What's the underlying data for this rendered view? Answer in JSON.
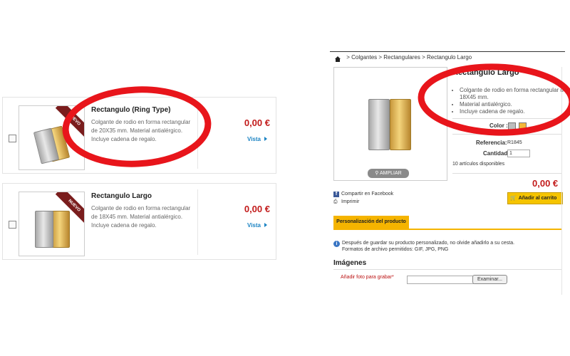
{
  "products": [
    {
      "title": "Rectangulo (Ring Type)",
      "description": "Colgante de rodio en forma rectangular de 20X35 mm. Material antialérgico. Incluye cadena de regalo.",
      "price": "0,00 €",
      "ribbon": "NUEVO",
      "link": "Vista"
    },
    {
      "title": "Rectangulo Largo",
      "description": "Colgante de rodio en forma rectangular de 18X45 mm. Material antialérgico. Incluye cadena de regalo.",
      "price": "0,00 €",
      "ribbon": "NUEVO",
      "link": "Vista"
    }
  ],
  "detail": {
    "breadcrumb": ">  Colgantes > Rectangulares > Rectangulo Largo",
    "title": "Rectangulo Largo",
    "features": [
      "Colgante de rodio en forma rectangular de 18X45 mm.",
      "Material antialérgico.",
      "Incluye cadena de regalo."
    ],
    "color_label": "Color :",
    "swatches": [
      "#bdbdbd",
      "#f4b73a"
    ],
    "reference_label": "Referencia:",
    "reference_value": "R1845",
    "quantity_label": "Cantidad",
    "quantity_value": "1",
    "stock": "10 artículos disponibles",
    "ampliar": "AMPLIAR",
    "price": "0,00 €",
    "add_to_cart": "Añadir al carrito",
    "share": "Compartir en Facebook",
    "print": "Imprimir",
    "tab": "Personalización del producto",
    "notice_line1": "Después de guardar su producto personalizado, no olvide añadirlo a su cesta.",
    "notice_line2": "Formatos de archivo permitidos: GIF, JPG, PNG",
    "images_heading": "Imágenes",
    "upload_label": "Añadir foto para grabar*",
    "browse": "Examinar..."
  }
}
